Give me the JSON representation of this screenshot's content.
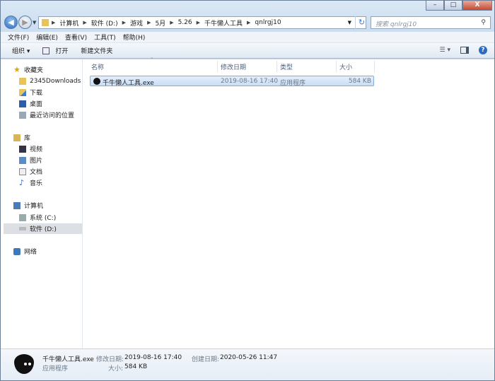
{
  "window": {
    "minimize": "–",
    "maximize": "□",
    "close": "X"
  },
  "address": {
    "segments": [
      "计算机",
      "软件 (D:)",
      "游戏",
      "5月",
      "5.26",
      "千牛懒人工具",
      "qnlrgj10"
    ],
    "search_placeholder": "搜索 qnlrgj10"
  },
  "menu": [
    "文件(F)",
    "编辑(E)",
    "查看(V)",
    "工具(T)",
    "帮助(H)"
  ],
  "toolbar": {
    "organize": "组织 ▾",
    "open": "打开",
    "new_folder": "新建文件夹"
  },
  "sidebar": {
    "favorites": "收藏夹",
    "fav_items": [
      "2345Downloads",
      "下载",
      "桌面",
      "最近访问的位置"
    ],
    "libraries": "库",
    "lib_items": [
      "视频",
      "图片",
      "文档",
      "音乐"
    ],
    "computer": "计算机",
    "drives": [
      "系统 (C:)",
      "软件 (D:)"
    ],
    "network": "网络"
  },
  "columns": [
    "名称",
    "修改日期",
    "类型",
    "大小"
  ],
  "files": [
    {
      "name": "千牛懒人工具.exe",
      "modified": "2019-08-16 17:40",
      "type": "应用程序",
      "size": "584 KB"
    }
  ],
  "details": {
    "name": "千牛懒人工具.exe",
    "type": "应用程序",
    "modified_label": "修改日期:",
    "modified": "2019-08-16 17:40",
    "created_label": "创建日期:",
    "created": "2020-05-26 11:47",
    "size_label": "大小:",
    "size": "584 KB"
  }
}
